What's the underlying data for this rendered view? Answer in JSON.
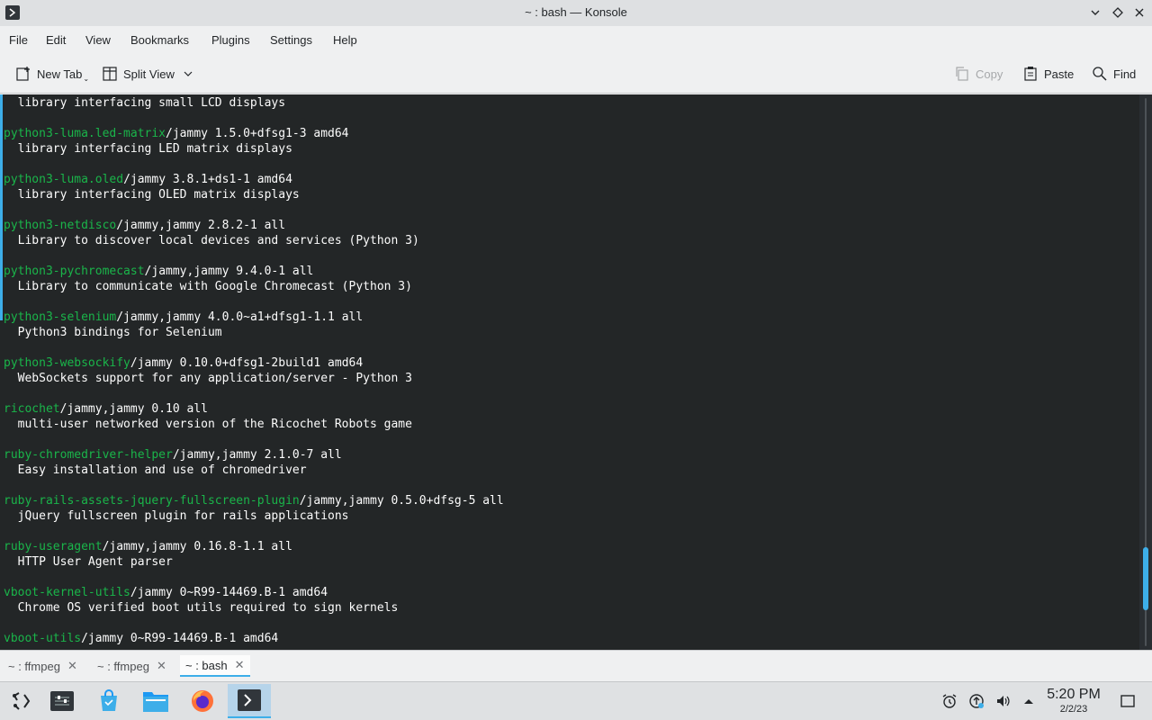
{
  "window": {
    "title": "~ : bash — Konsole"
  },
  "menu": [
    "File",
    "Edit",
    "View",
    "Bookmarks",
    "Plugins",
    "Settings",
    "Help"
  ],
  "toolbar": {
    "new_tab": "New Tab",
    "split_view": "Split View",
    "copy": "Copy",
    "paste": "Paste",
    "find": "Find"
  },
  "terminal": {
    "lines": [
      {
        "pkg": "",
        "rest": "  library interfacing small LCD displays"
      },
      {
        "pkg": "",
        "rest": ""
      },
      {
        "pkg": "python3-luma.led-matrix",
        "rest": "/jammy 1.5.0+dfsg1-3 amd64"
      },
      {
        "pkg": "",
        "rest": "  library interfacing LED matrix displays"
      },
      {
        "pkg": "",
        "rest": ""
      },
      {
        "pkg": "python3-luma.oled",
        "rest": "/jammy 3.8.1+ds1-1 amd64"
      },
      {
        "pkg": "",
        "rest": "  library interfacing OLED matrix displays"
      },
      {
        "pkg": "",
        "rest": ""
      },
      {
        "pkg": "python3-netdisco",
        "rest": "/jammy,jammy 2.8.2-1 all"
      },
      {
        "pkg": "",
        "rest": "  Library to discover local devices and services (Python 3)"
      },
      {
        "pkg": "",
        "rest": ""
      },
      {
        "pkg": "python3-pychromecast",
        "rest": "/jammy,jammy 9.4.0-1 all"
      },
      {
        "pkg": "",
        "rest": "  Library to communicate with Google Chromecast (Python 3)"
      },
      {
        "pkg": "",
        "rest": ""
      },
      {
        "pkg": "python3-selenium",
        "rest": "/jammy,jammy 4.0.0~a1+dfsg1-1.1 all"
      },
      {
        "pkg": "",
        "rest": "  Python3 bindings for Selenium"
      },
      {
        "pkg": "",
        "rest": ""
      },
      {
        "pkg": "python3-websockify",
        "rest": "/jammy 0.10.0+dfsg1-2build1 amd64"
      },
      {
        "pkg": "",
        "rest": "  WebSockets support for any application/server - Python 3"
      },
      {
        "pkg": "",
        "rest": ""
      },
      {
        "pkg": "ricochet",
        "rest": "/jammy,jammy 0.10 all"
      },
      {
        "pkg": "",
        "rest": "  multi-user networked version of the Ricochet Robots game"
      },
      {
        "pkg": "",
        "rest": ""
      },
      {
        "pkg": "ruby-chromedriver-helper",
        "rest": "/jammy,jammy 2.1.0-7 all"
      },
      {
        "pkg": "",
        "rest": "  Easy installation and use of chromedriver"
      },
      {
        "pkg": "",
        "rest": ""
      },
      {
        "pkg": "ruby-rails-assets-jquery-fullscreen-plugin",
        "rest": "/jammy,jammy 0.5.0+dfsg-5 all"
      },
      {
        "pkg": "",
        "rest": "  jQuery fullscreen plugin for rails applications"
      },
      {
        "pkg": "",
        "rest": ""
      },
      {
        "pkg": "ruby-useragent",
        "rest": "/jammy,jammy 0.16.8-1.1 all"
      },
      {
        "pkg": "",
        "rest": "  HTTP User Agent parser"
      },
      {
        "pkg": "",
        "rest": ""
      },
      {
        "pkg": "vboot-kernel-utils",
        "rest": "/jammy 0~R99-14469.B-1 amd64"
      },
      {
        "pkg": "",
        "rest": "  Chrome OS verified boot utils required to sign kernels"
      },
      {
        "pkg": "",
        "rest": ""
      },
      {
        "pkg": "vboot-utils",
        "rest": "/jammy 0~R99-14469.B-1 amd64"
      }
    ],
    "colors": {
      "background": "#232627",
      "text": "#fcfcfc",
      "package": "#1ab54a",
      "accent": "#3daee9"
    }
  },
  "tabs": [
    {
      "label": "~ : ffmpeg",
      "active": false
    },
    {
      "label": "~ : ffmpeg",
      "active": false
    },
    {
      "label": "~ : bash",
      "active": true
    }
  ],
  "taskbar": {
    "apps": [
      "application-launcher-icon",
      "system-settings-icon",
      "discover-store-icon",
      "file-manager-icon",
      "firefox-icon",
      "konsole-icon"
    ],
    "clock_time": "5:20 PM",
    "clock_date": "2/2/23"
  }
}
